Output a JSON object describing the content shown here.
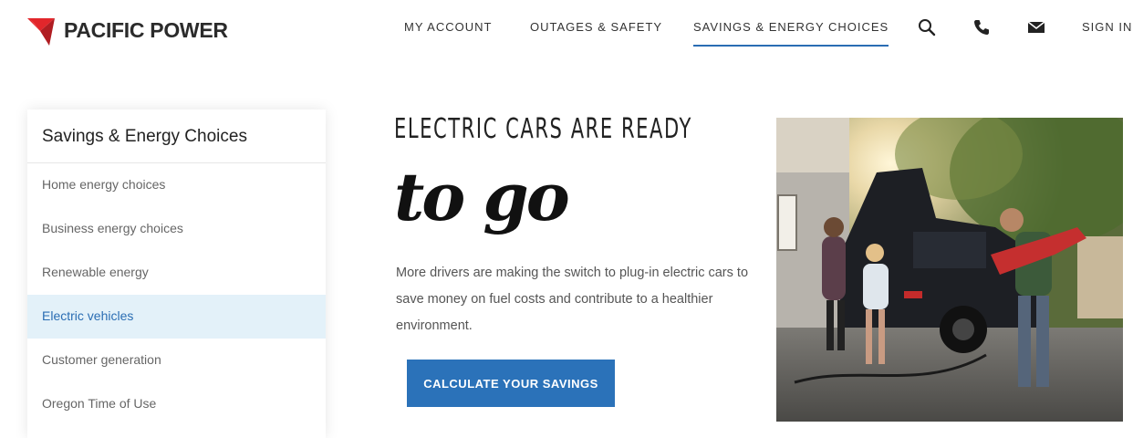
{
  "brand": {
    "name": "PACIFIC POWER",
    "logo_color": "#e2262b"
  },
  "nav": {
    "items": [
      {
        "label": "MY ACCOUNT"
      },
      {
        "label": "OUTAGES & SAFETY"
      },
      {
        "label": "SAVINGS & ENERGY CHOICES",
        "active": true
      }
    ],
    "icons": [
      "search-icon",
      "phone-icon",
      "mail-icon"
    ],
    "sign_in": "SIGN IN",
    "accent": "#2a6db3"
  },
  "sidebar": {
    "title": "Savings & Energy Choices",
    "items": [
      {
        "label": "Home energy choices"
      },
      {
        "label": "Business energy choices"
      },
      {
        "label": "Renewable energy"
      },
      {
        "label": "Electric vehicles",
        "active": true
      },
      {
        "label": "Customer generation"
      },
      {
        "label": "Oregon Time of Use"
      }
    ]
  },
  "hero": {
    "headline": "ELECTRIC CARS ARE READY",
    "script": "to go",
    "body": "More drivers are making the switch to plug-in electric cars to save money on fuel costs and contribute to a healthier environment.",
    "cta": "CALCULATE YOUR SAVINGS",
    "cta_color": "#2b72b9"
  }
}
